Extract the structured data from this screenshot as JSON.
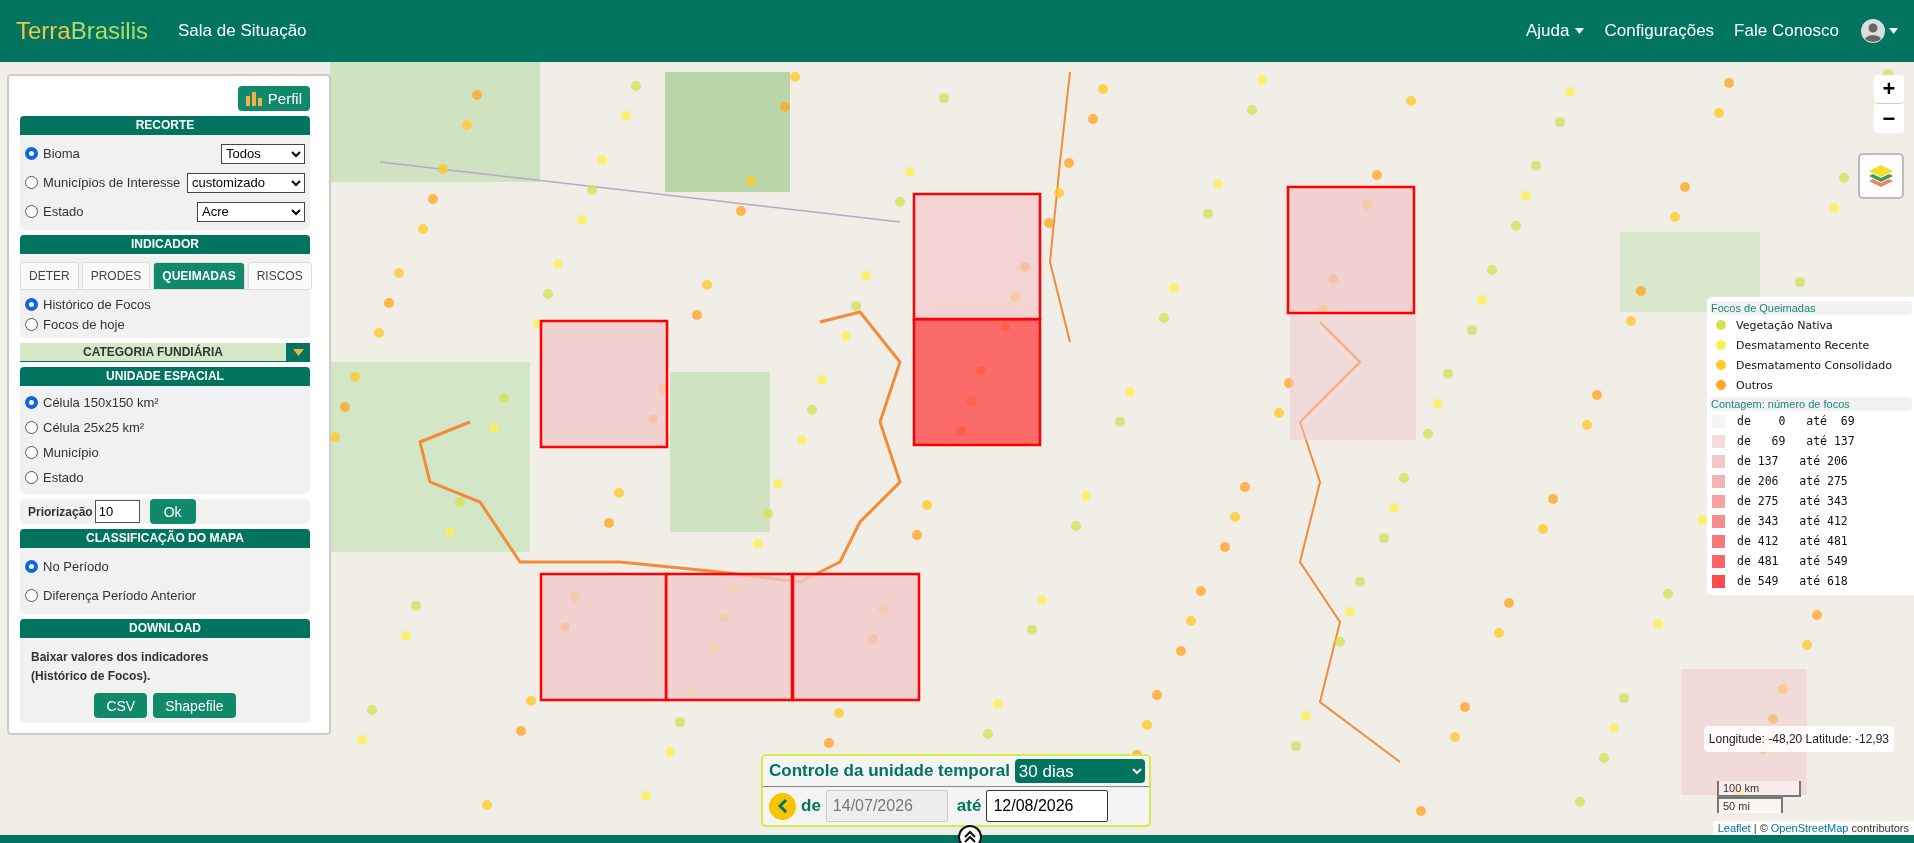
{
  "header": {
    "logo": {
      "first": "Terra",
      "second": "Brasilis"
    },
    "title": "Sala de Situação",
    "nav": [
      {
        "label": "Ajuda",
        "kind": "dropdown"
      },
      {
        "label": "Configurações",
        "kind": "link"
      },
      {
        "label": "Fale Conosco",
        "kind": "link"
      }
    ]
  },
  "panel": {
    "profile_button": "Perfil",
    "recorte": {
      "title": "RECORTE",
      "options": [
        {
          "label": "Bioma",
          "selected": true,
          "value": "Todos"
        },
        {
          "label": "Municípios de Interesse",
          "selected": false,
          "value": "customizado"
        },
        {
          "label": "Estado",
          "selected": false,
          "value": "Acre"
        }
      ]
    },
    "indicador": {
      "title": "INDICADOR",
      "tabs": [
        {
          "label": "DETER",
          "selected": false
        },
        {
          "label": "PRODES",
          "selected": false
        },
        {
          "label": "QUEIMADAS",
          "selected": true
        },
        {
          "label": "RISCOS",
          "selected": false
        }
      ],
      "options": [
        {
          "label": "Histórico de Focos",
          "selected": true
        },
        {
          "label": "Focos de hoje",
          "selected": false
        }
      ]
    },
    "categoria": {
      "title": "CATEGORIA FUNDIÁRIA",
      "expanded": false
    },
    "unidade": {
      "title": "UNIDADE ESPACIAL",
      "options": [
        {
          "label": "Célula 150x150 km²",
          "selected": true
        },
        {
          "label": "Célula 25x25 km²",
          "selected": false
        },
        {
          "label": "Município",
          "selected": false
        },
        {
          "label": "Estado",
          "selected": false
        }
      ]
    },
    "priorizacao": {
      "label": "Priorização",
      "value": "10",
      "button": "Ok"
    },
    "classificacao": {
      "title": "CLASSIFICAÇÃO DO MAPA",
      "options": [
        {
          "label": "No Período",
          "selected": true
        },
        {
          "label": "Diferença Período Anterior",
          "selected": false
        }
      ]
    },
    "download": {
      "title": "DOWNLOAD",
      "text": "Baixar valores dos indicadores (Histórico de Focos).",
      "buttons": [
        "CSV",
        "Shapefile"
      ]
    }
  },
  "map_controls": {
    "zoom_in": "+",
    "zoom_out": "−"
  },
  "legend": {
    "focos_title": "Focos de Queimadas",
    "focos": [
      {
        "label": "Vegetação Nativa",
        "color": "#d4e157"
      },
      {
        "label": "Desmatamento Recente",
        "color": "#ffee58"
      },
      {
        "label": "Desmatamento Consolidado",
        "color": "#ffca28"
      },
      {
        "label": "Outros",
        "color": "#ffa726"
      }
    ],
    "count_title": "Contagem: número de focos",
    "counts": [
      {
        "text": "de    0   até  69",
        "color": "#f5f5f5"
      },
      {
        "text": "de   69   até 137",
        "color": "#f2dcdc"
      },
      {
        "text": "de 137   até 206",
        "color": "#f2c8c8"
      },
      {
        "text": "de 206   até 275",
        "color": "#f2b5b5"
      },
      {
        "text": "de 275   até 343",
        "color": "#f4a3a3"
      },
      {
        "text": "de 343   até 412",
        "color": "#f58d8d"
      },
      {
        "text": "de 412   até 481",
        "color": "#f77a7a"
      },
      {
        "text": "de 481   até 549",
        "color": "#fa6464"
      },
      {
        "text": "de 549   até 618",
        "color": "#fd4a4a"
      }
    ]
  },
  "temporal": {
    "title": "Controle da unidade temporal",
    "period": "30 dias",
    "from_label": "de",
    "from": "14/07/2026",
    "from_disabled": true,
    "to_label": "até",
    "to": "12/08/2026"
  },
  "coordinates": "Longitude: -48,20 Latitude: -12,93",
  "scale": {
    "metric": "100 km",
    "imperial": "50 mi"
  },
  "attribution": {
    "link1": "Leaflet",
    "middle": " | © ",
    "link2": "OpenStreetMap",
    "end": " contributors"
  }
}
